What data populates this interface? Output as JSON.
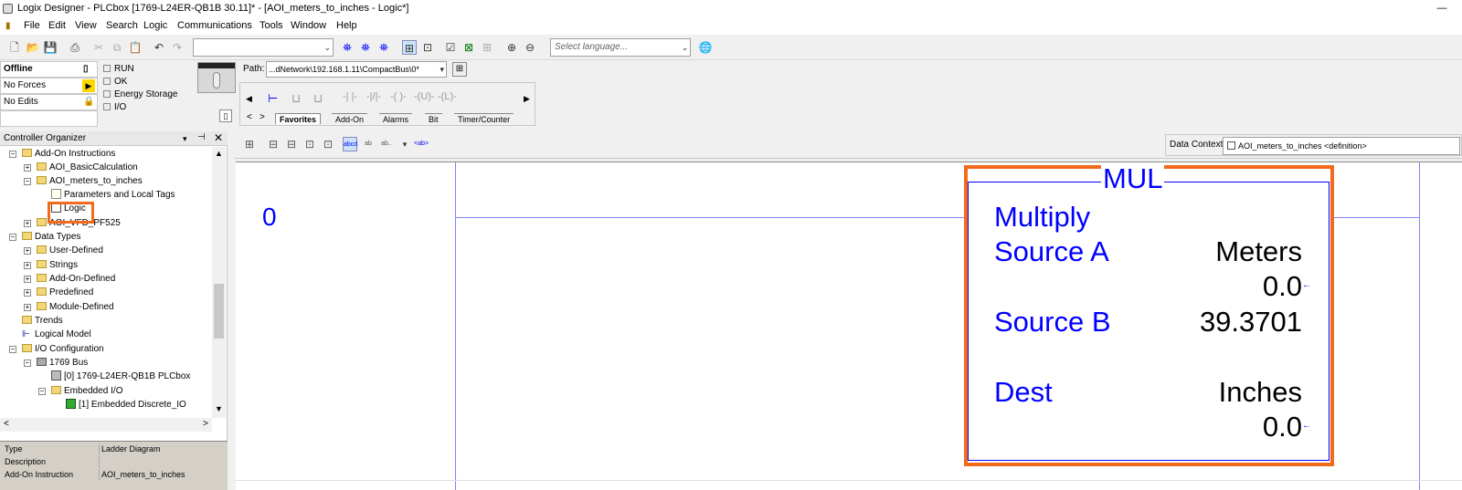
{
  "window": {
    "title": "Logix Designer - PLCbox [1769-L24ER-QB1B 30.11]* - [AOI_meters_to_inches - Logic*]",
    "minimize": "—"
  },
  "menu": [
    "File",
    "Edit",
    "View",
    "Search",
    "Logic",
    "Communications",
    "Tools",
    "Window",
    "Help"
  ],
  "toolbar": {
    "combo_value": "",
    "language_placeholder": "Select language..."
  },
  "status": {
    "mode": "Offline",
    "forces": "No Forces",
    "edits": "No Edits",
    "indicators": [
      "RUN",
      "OK",
      "Energy Storage",
      "I/O"
    ]
  },
  "path": {
    "label": "Path:",
    "value": "...dNetwork\\192.168.1.11\\CompactBus\\0*"
  },
  "instruction_tabs": [
    "Favorites",
    "Add-On",
    "Alarms",
    "Bit",
    "Timer/Counter"
  ],
  "organizer": {
    "title": "Controller Organizer",
    "tree": [
      {
        "label": "Add-On Instructions",
        "level": 0
      },
      {
        "label": "AOI_BasicCalculation",
        "level": 1
      },
      {
        "label": "AOI_meters_to_inches",
        "level": 1
      },
      {
        "label": "Parameters and Local Tags",
        "level": 2
      },
      {
        "label": "Logic",
        "level": 2
      },
      {
        "label": "AOI_VFD_PF525",
        "level": 1
      },
      {
        "label": "Data Types",
        "level": 0
      },
      {
        "label": "User-Defined",
        "level": 1
      },
      {
        "label": "Strings",
        "level": 1
      },
      {
        "label": "Add-On-Defined",
        "level": 1
      },
      {
        "label": "Predefined",
        "level": 1
      },
      {
        "label": "Module-Defined",
        "level": 1
      },
      {
        "label": "Trends",
        "level": 0
      },
      {
        "label": "Logical Model",
        "level": 0
      },
      {
        "label": "I/O Configuration",
        "level": 0
      },
      {
        "label": "1769 Bus",
        "level": 1
      },
      {
        "label": "[0] 1769-L24ER-QB1B PLCbox",
        "level": 2
      },
      {
        "label": "Embedded I/O",
        "level": 2
      },
      {
        "label": "[1] Embedded Discrete_IO",
        "level": 3
      }
    ]
  },
  "properties": [
    {
      "key": "Type",
      "value": "Ladder Diagram"
    },
    {
      "key": "Description",
      "value": ""
    },
    {
      "key": "Add-On Instruction",
      "value": "AOI_meters_to_inches"
    }
  ],
  "editor": {
    "data_context_label": "Data Context:",
    "data_context_value": "AOI_meters_to_inches <definition>"
  },
  "ladder": {
    "rung_number": "0",
    "instruction": {
      "name": "MUL",
      "description": "Multiply",
      "source_a_label": "Source A",
      "source_a_tag": "Meters",
      "source_a_value": "0.0",
      "source_b_label": "Source B",
      "source_b_value": "39.3701",
      "dest_label": "Dest",
      "dest_tag": "Inches",
      "dest_value": "0.0"
    }
  },
  "colors": {
    "highlight": "#f26a1b",
    "ladder_blue": "#0000ff"
  }
}
